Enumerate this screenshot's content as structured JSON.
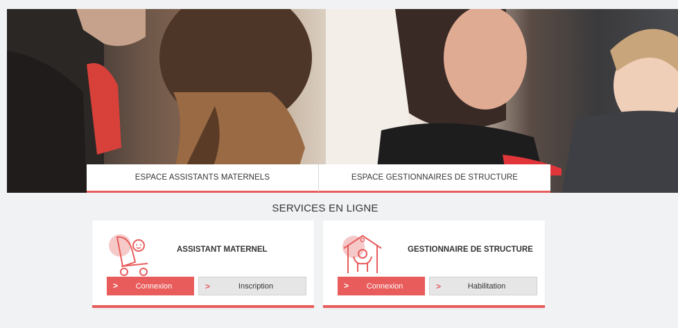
{
  "hero": {
    "tabs": [
      {
        "label": "ESPACE ASSISTANTS MATERNELS"
      },
      {
        "label": "ESPACE GESTIONNAIRES DE STRUCTURE"
      }
    ]
  },
  "section": {
    "title": "SERVICES EN LIGNE"
  },
  "cards": [
    {
      "title": "ASSISTANT MATERNEL",
      "icon": "stroller-baby-icon",
      "primary_label": "Connexion",
      "secondary_label": "Inscription"
    },
    {
      "title": "GESTIONNAIRE DE STRUCTURE",
      "icon": "house-child-icon",
      "primary_label": "Connexion",
      "secondary_label": "Habilitation"
    }
  ],
  "colors": {
    "accent": "#e85c5c",
    "background": "#f1f2f4",
    "secondary_button": "#e6e6e6"
  }
}
